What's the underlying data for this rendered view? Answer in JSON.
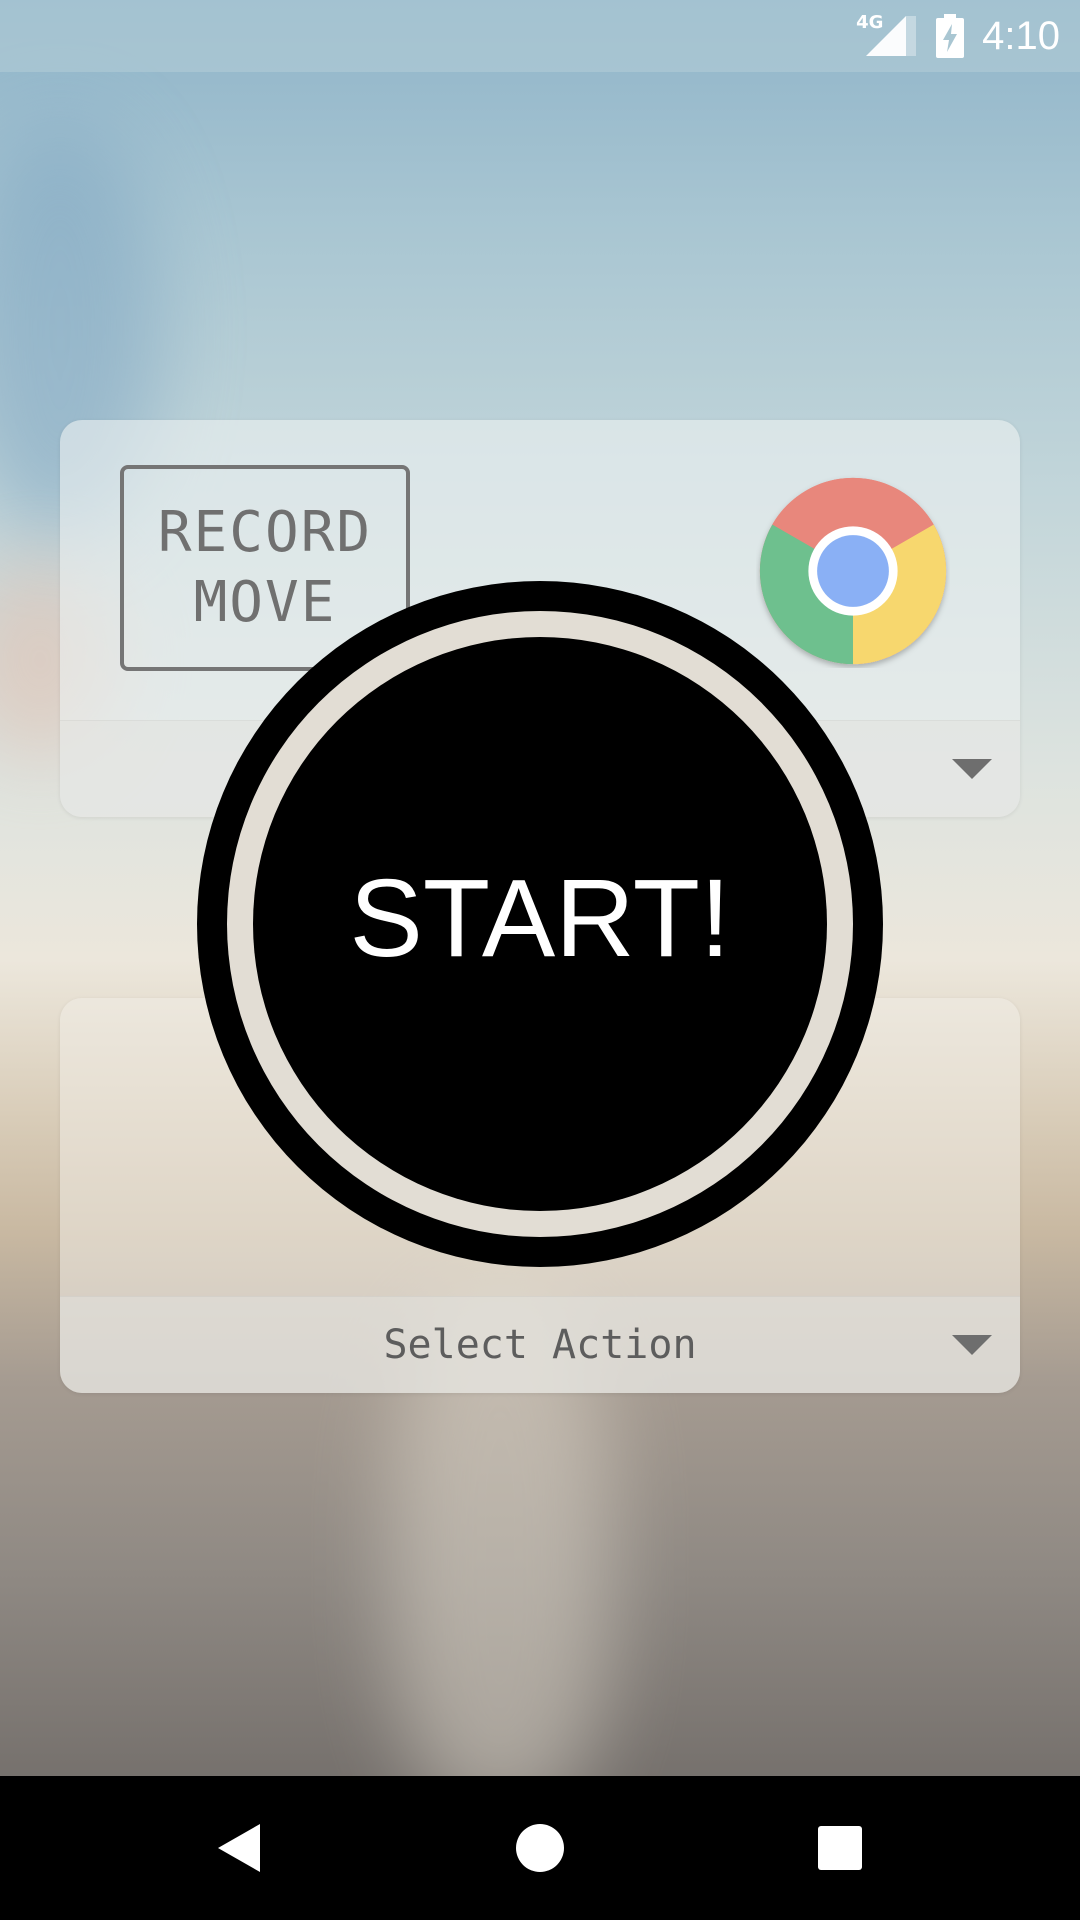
{
  "status_bar": {
    "network_type": "4G",
    "time": "4:10",
    "icons": [
      "signal-icon",
      "battery-charging-icon"
    ]
  },
  "top_card": {
    "record_button": {
      "line1": "RECORD",
      "line2": "MOVE"
    },
    "app_icon": "chrome-icon",
    "spinner_value": ""
  },
  "start_button": {
    "label": "START!"
  },
  "bottom_card": {
    "icon": "app-placeholder-icon",
    "spinner_value": "Select Action"
  },
  "nav_bar": {
    "icons": [
      "back-icon",
      "home-icon",
      "recents-icon"
    ]
  },
  "colors": {
    "start_button": "#000000",
    "start_ring_gap": "#f5f0e6",
    "chrome_red": "#e8877b",
    "chrome_green": "#6ec08e",
    "chrome_yellow": "#f7d76e",
    "chrome_blue": "#8ab0f5"
  }
}
